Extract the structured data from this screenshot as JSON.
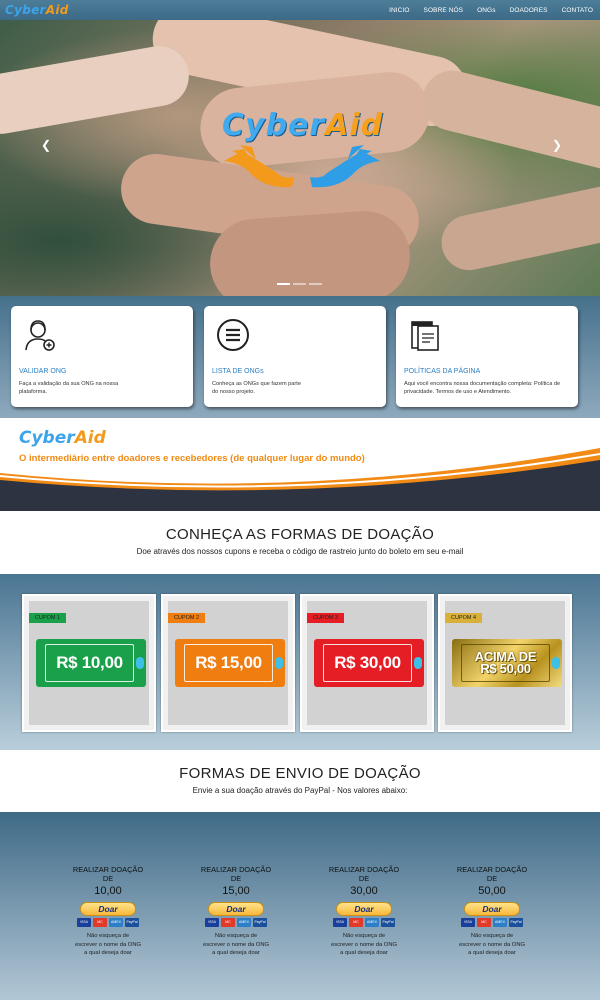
{
  "nav": {
    "logo_part1": "Cyber",
    "logo_part2": "Aid",
    "links": [
      "INICIO",
      "SOBRE NÓS",
      "ONGs",
      "DOADORES",
      "CONTATO"
    ]
  },
  "hero": {
    "logo_part1": "Cyber",
    "logo_part2": "Aid",
    "prev_icon": "chevron-left-icon",
    "next_icon": "chevron-right-icon",
    "slides": 3,
    "active_slide": 0
  },
  "cards": [
    {
      "title": "VALIDAR ONG",
      "text": "Faça a validação da sua ONG na nossa plataforma.",
      "icon": "support-agent-icon"
    },
    {
      "title": "LISTA DE ONGs",
      "text": "Conheça as ONGs que fazem parte do nosso projeto.",
      "icon": "list-icon"
    },
    {
      "title": "POLÍTICAS DA PÁGINA",
      "text": "Aqui você encontra nossa documentação completa: Política de privacidade. Termos de uso e Atendimento.",
      "icon": "documents-icon"
    }
  ],
  "banner": {
    "logo_part1": "Cyber",
    "logo_part2": "Aid",
    "tagline": "O intermediário entre doadores e recebedores (de qualquer lugar do mundo)"
  },
  "donation_forms": {
    "title": "CONHEÇA AS FORMAS DE DOAÇÃO",
    "subtitle": "Doe através dos nossos cupons e receba o código de rastreio junto do boleto em seu e-mail"
  },
  "coupons": [
    {
      "tag": "CUPOM 1",
      "amount": "R$ 10,00",
      "color": "#1aa04a",
      "tag_color": "#1aa04a"
    },
    {
      "tag": "CUPOM 2",
      "amount": "R$ 15,00",
      "color": "#f07d0f",
      "tag_color": "#f07d0f"
    },
    {
      "tag": "CUPOM 3",
      "amount": "R$ 30,00",
      "color": "#e51e25",
      "tag_color": "#e51e25"
    },
    {
      "tag": "CUPOM 4",
      "amount_line1": "ACIMA DE",
      "amount_line2": "R$ 50,00",
      "color": "#c9a227",
      "tag_color": "#d9b13a"
    }
  ],
  "send_forms": {
    "title": "FORMAS DE ENVIO DE DOAÇÃO",
    "subtitle": "Envie a sua doação através do PayPal - Nos valores abaixo:"
  },
  "paypal": {
    "button_label": "Doar",
    "card_brands": [
      "VISA",
      "MC",
      "AMEX",
      "PayPal"
    ],
    "options": [
      {
        "label_line1": "REALIZAR DOAÇÃO",
        "label_line2": "DE",
        "value": "10,00",
        "note_line1": "Não esqueça de",
        "note_line2": "escrever o nome da ONG",
        "note_line3": "a qual deseja doar"
      },
      {
        "label_line1": "REALIZAR DOAÇÃO",
        "label_line2": "DE",
        "value": "15,00",
        "note_line1": "Não esqueça de",
        "note_line2": "escrever o nome da ONG",
        "note_line3": "a qual deseja doar"
      },
      {
        "label_line1": "REALIZAR DOAÇÃO",
        "label_line2": "DE",
        "value": "30,00",
        "note_line1": "Não esqueça de",
        "note_line2": "escrever o nome da ONG",
        "note_line3": "a qual deseja doar"
      },
      {
        "label_line1": "REALIZAR DOAÇÃO",
        "label_line2": "DE",
        "value": "50,00",
        "note_line1": "Não esqueça de",
        "note_line2": "escrever o nome da ONG",
        "note_line3": "a qual deseja doar"
      }
    ]
  },
  "colors": {
    "nav_bg": "#46738f",
    "brand_blue": "#3ca4ea",
    "brand_orange": "#f39a1d",
    "card_title": "#2a7fc4",
    "banner_dark": "#2d3340"
  }
}
